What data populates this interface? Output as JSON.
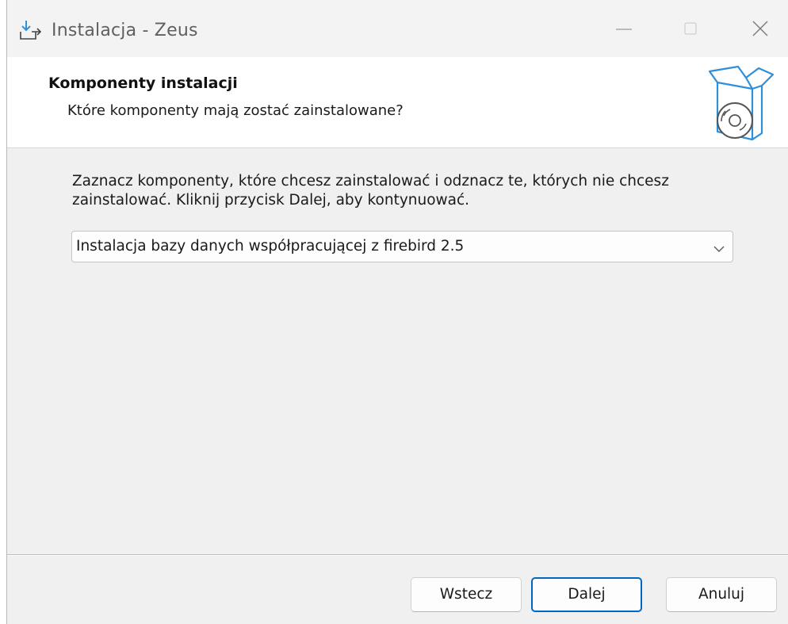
{
  "window": {
    "title": "Instalacja - Zeus",
    "icon": "installer-download-icon",
    "controls": {
      "minimize": "minimize-icon",
      "maximize": "maximize-icon",
      "close": "close-icon"
    }
  },
  "header": {
    "title": "Komponenty instalacji",
    "subtitle": "Które komponenty mają zostać zainstalowane?",
    "image": "package-box-disc-icon"
  },
  "main": {
    "description": "Zaznacz komponenty, które chcesz zainstalować i odznacz te, których nie chcesz zainstalować. Kliknij przycisk Dalej, aby kontynuować.",
    "component_select": {
      "selected": "Instalacja bazy danych współpracującej z firebird 2.5",
      "icon": "chevron-down-icon"
    }
  },
  "footer": {
    "back_label": "Wstecz",
    "next_label": "Dalej",
    "cancel_label": "Anuluj"
  },
  "colors": {
    "accent": "#0067c0",
    "icon_blue": "#2f8fd8",
    "window_bg": "#f0f0f0",
    "header_bg": "#ffffff"
  }
}
